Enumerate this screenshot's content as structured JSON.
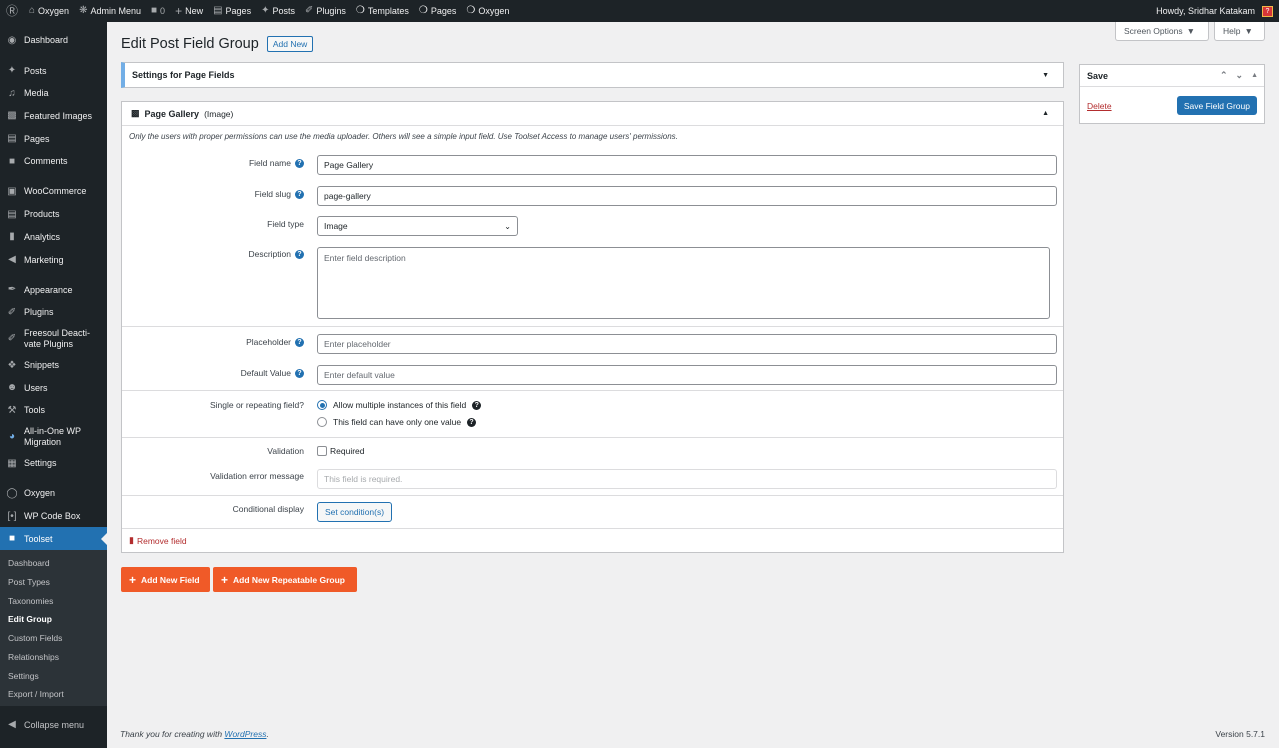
{
  "adminbar": {
    "site_name": "Oxygen",
    "admin_menu": "Admin Menu",
    "comments_count": "0",
    "new": "New",
    "pages": "Pages",
    "posts": "Posts",
    "plugins": "Plugins",
    "templates": "Templates",
    "oxygen_pages": "Pages",
    "oxygen": "Oxygen",
    "howdy": "Howdy, Sridhar Katakam"
  },
  "sidebar": {
    "items": [
      {
        "label": "Dashboard",
        "icon": "dashboard-icon"
      },
      {
        "label": "Posts",
        "icon": "pin-icon"
      },
      {
        "label": "Media",
        "icon": "media-icon"
      },
      {
        "label": "Featured Images",
        "icon": "image-icon"
      },
      {
        "label": "Pages",
        "icon": "page-icon"
      },
      {
        "label": "Comments",
        "icon": "comment-icon"
      },
      {
        "label": "WooCommerce",
        "icon": "woo-icon"
      },
      {
        "label": "Products",
        "icon": "archive-icon"
      },
      {
        "label": "Analytics",
        "icon": "chart-icon"
      },
      {
        "label": "Marketing",
        "icon": "megaphone-icon"
      },
      {
        "label": "Appearance",
        "icon": "brush-icon"
      },
      {
        "label": "Plugins",
        "icon": "plugin-icon"
      },
      {
        "label": "Freesoul Deactivate Plugins",
        "line1": "Freesoul Deacti-",
        "line2": "vate Plugins",
        "icon": "plugin-icon"
      },
      {
        "label": "Snippets",
        "icon": "snippet-icon"
      },
      {
        "label": "Users",
        "icon": "user-icon"
      },
      {
        "label": "Tools",
        "icon": "wrench-icon"
      },
      {
        "label": "All-in-One WP Migration",
        "line1": "All-in-One WP",
        "line2": "Migration",
        "icon": "migration-icon"
      },
      {
        "label": "Settings",
        "icon": "settings-icon"
      },
      {
        "label": "Oxygen",
        "icon": "oxygen-icon"
      },
      {
        "label": "WP Code Box",
        "icon": "code-icon"
      },
      {
        "label": "Toolset",
        "icon": "toolset-icon"
      }
    ],
    "submenu": [
      "Dashboard",
      "Post Types",
      "Taxonomies",
      "Edit Group",
      "Custom Fields",
      "Relationships",
      "Settings",
      "Export / Import"
    ],
    "collapse": "Collapse menu"
  },
  "header": {
    "title": "Edit Post Field Group",
    "add_new": "Add New",
    "screen_options": "Screen Options",
    "help": "Help"
  },
  "settings_panel": {
    "title": "Settings for Page Fields"
  },
  "field": {
    "title": "Page Gallery",
    "type_label": "(Image)",
    "note": "Only the users with proper permissions can use the media uploader. Others will see a simple input field. Use Toolset Access to manage users' permissions.",
    "name_label": "Field name",
    "name_value": "Page Gallery",
    "slug_label": "Field slug",
    "slug_value": "page-gallery",
    "type_field_label": "Field type",
    "type_value": "Image",
    "description_label": "Description",
    "description_placeholder": "Enter field description",
    "placeholder_label": "Placeholder",
    "placeholder_placeholder": "Enter placeholder",
    "default_label": "Default Value",
    "default_placeholder": "Enter default value",
    "repeat_label": "Single or repeating field?",
    "repeat_multiple": "Allow multiple instances of this field",
    "repeat_single": "This field can have only one value",
    "validation_label": "Validation",
    "required": "Required",
    "validation_error_label": "Validation error message",
    "validation_error_value": "This field is required.",
    "conditional_label": "Conditional display",
    "set_conditions": "Set condition(s)",
    "remove": "Remove field"
  },
  "buttons": {
    "add_field": "Add New Field",
    "add_group": "Add New Repeatable Group"
  },
  "save_box": {
    "title": "Save",
    "delete": "Delete",
    "save": "Save Field Group"
  },
  "footer": {
    "thanks": "Thank you for creating with ",
    "wordpress": "WordPress",
    "period": ".",
    "version": "Version 5.7.1"
  },
  "colors": {
    "accent": "#2271b1",
    "orange": "#f05a28",
    "sidebar": "#1d2327",
    "danger": "#b32d2e"
  }
}
